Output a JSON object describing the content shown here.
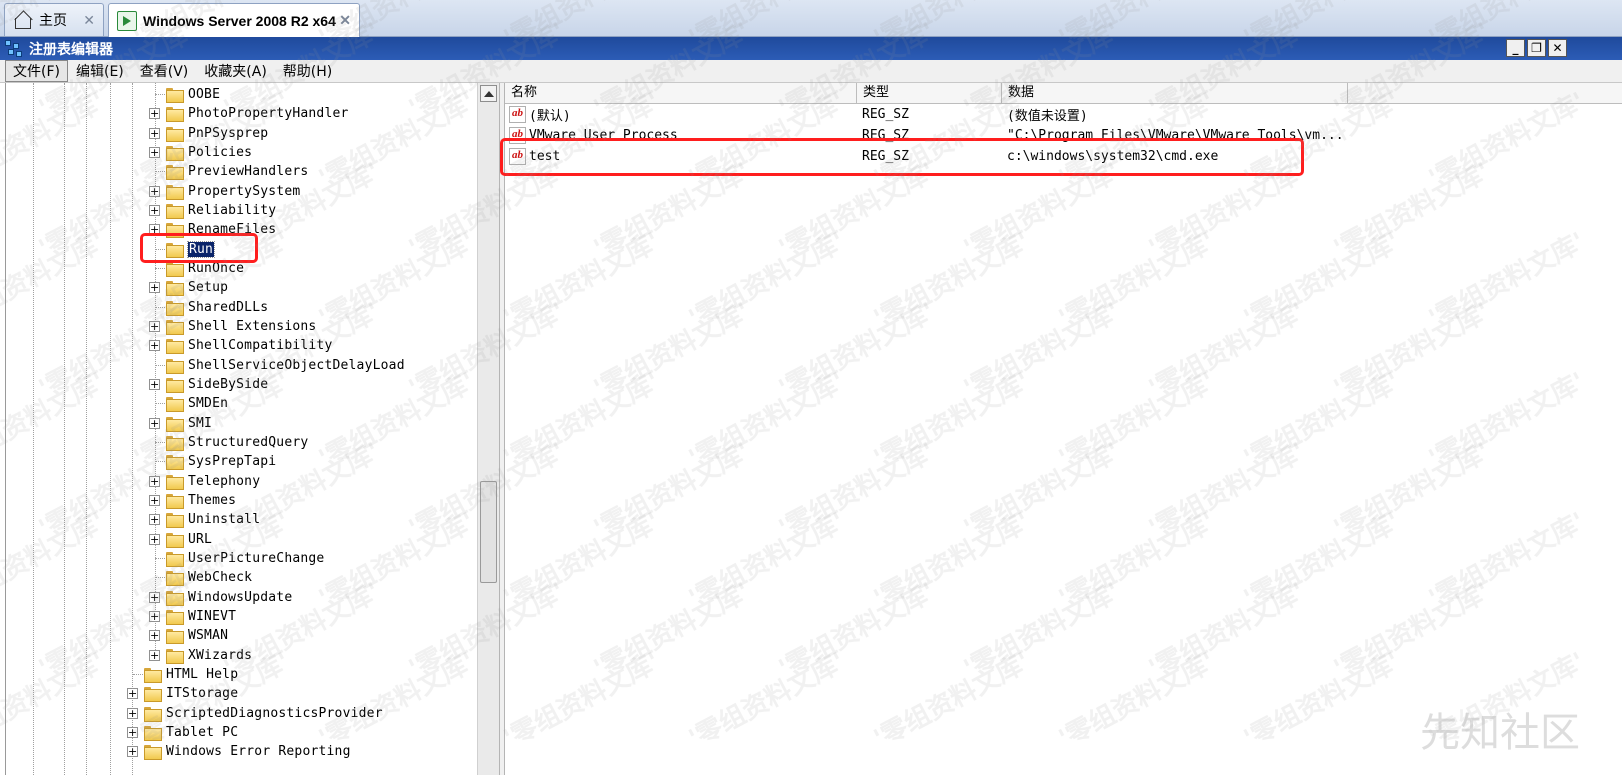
{
  "host_tabs": [
    {
      "label": "主页",
      "icon": "home-icon"
    },
    {
      "label": "Windows Server 2008 R2 x64",
      "icon": "vm-icon"
    }
  ],
  "window": {
    "title": "注册表编辑器",
    "controls": {
      "minimize": "_",
      "restore": "❐",
      "close": "✕"
    }
  },
  "menu": [
    "文件(F)",
    "编辑(E)",
    "查看(V)",
    "收藏夹(A)",
    "帮助(H)"
  ],
  "tree": {
    "items": [
      {
        "label": "OOBE",
        "expandable": false,
        "level": 2
      },
      {
        "label": "PhotoPropertyHandler",
        "expandable": true,
        "level": 2
      },
      {
        "label": "PnPSysprep",
        "expandable": true,
        "level": 2
      },
      {
        "label": "Policies",
        "expandable": true,
        "level": 2
      },
      {
        "label": "PreviewHandlers",
        "expandable": false,
        "level": 2
      },
      {
        "label": "PropertySystem",
        "expandable": true,
        "level": 2
      },
      {
        "label": "Reliability",
        "expandable": true,
        "level": 2
      },
      {
        "label": "RenameFiles",
        "expandable": true,
        "level": 2
      },
      {
        "label": "Run",
        "expandable": false,
        "level": 2,
        "selected": true
      },
      {
        "label": "RunOnce",
        "expandable": false,
        "level": 2
      },
      {
        "label": "Setup",
        "expandable": true,
        "level": 2
      },
      {
        "label": "SharedDLLs",
        "expandable": false,
        "level": 2
      },
      {
        "label": "Shell Extensions",
        "expandable": true,
        "level": 2
      },
      {
        "label": "ShellCompatibility",
        "expandable": true,
        "level": 2
      },
      {
        "label": "ShellServiceObjectDelayLoad",
        "expandable": false,
        "level": 2
      },
      {
        "label": "SideBySide",
        "expandable": true,
        "level": 2
      },
      {
        "label": "SMDEn",
        "expandable": false,
        "level": 2
      },
      {
        "label": "SMI",
        "expandable": true,
        "level": 2
      },
      {
        "label": "StructuredQuery",
        "expandable": false,
        "level": 2
      },
      {
        "label": "SysPrepTapi",
        "expandable": false,
        "level": 2
      },
      {
        "label": "Telephony",
        "expandable": true,
        "level": 2
      },
      {
        "label": "Themes",
        "expandable": true,
        "level": 2
      },
      {
        "label": "Uninstall",
        "expandable": true,
        "level": 2
      },
      {
        "label": "URL",
        "expandable": true,
        "level": 2
      },
      {
        "label": "UserPictureChange",
        "expandable": false,
        "level": 2
      },
      {
        "label": "WebCheck",
        "expandable": false,
        "level": 2
      },
      {
        "label": "WindowsUpdate",
        "expandable": true,
        "level": 2
      },
      {
        "label": "WINEVT",
        "expandable": true,
        "level": 2
      },
      {
        "label": "WSMAN",
        "expandable": true,
        "level": 2
      },
      {
        "label": "XWizards",
        "expandable": true,
        "level": 2
      },
      {
        "label": "HTML Help",
        "expandable": false,
        "level": 1
      },
      {
        "label": "ITStorage",
        "expandable": true,
        "level": 1
      },
      {
        "label": "ScriptedDiagnosticsProvider",
        "expandable": true,
        "level": 1
      },
      {
        "label": "Tablet PC",
        "expandable": true,
        "level": 1
      },
      {
        "label": "Windows Error Reporting",
        "expandable": true,
        "level": 1
      }
    ]
  },
  "list": {
    "columns": [
      "名称",
      "类型",
      "数据"
    ],
    "rows": [
      {
        "name": "(默认)",
        "type": "REG_SZ",
        "data": "(数值未设置)"
      },
      {
        "name": "VMware User Process",
        "type": "REG_SZ",
        "data": "\"C:\\Program Files\\VMware\\VMware Tools\\vm..."
      },
      {
        "name": "test",
        "type": "REG_SZ",
        "data": "c:\\windows\\system32\\cmd.exe"
      }
    ]
  },
  "watermark": {
    "text": "'零组资料文库'",
    "logo": "先知社区"
  },
  "colors": {
    "highlight": "#ff1e1e",
    "titlebar": "#1f4a9c",
    "selection": "#0a246a"
  }
}
